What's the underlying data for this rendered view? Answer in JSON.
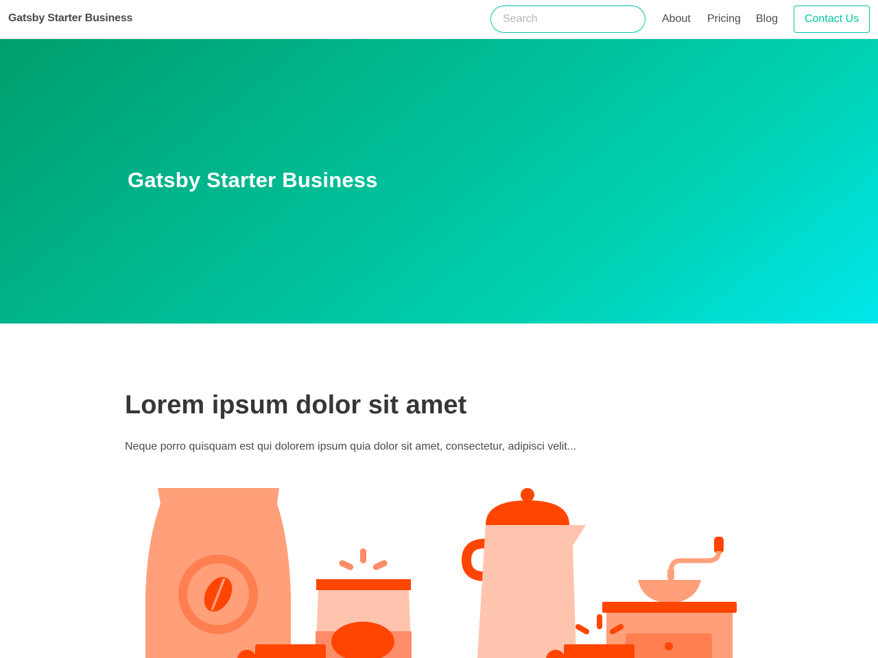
{
  "navbar": {
    "brand": "Gatsby Starter Business",
    "search_placeholder": "Search",
    "links": [
      {
        "label": "About"
      },
      {
        "label": "Pricing"
      },
      {
        "label": "Blog"
      }
    ],
    "contact_label": "Contact Us"
  },
  "hero": {
    "title": "Gatsby Starter Business"
  },
  "content": {
    "title": "Lorem ipsum dolor sit amet",
    "text": "Neque porro quisquam est qui dolorem ipsum quia dolor sit amet, consectetur, adipisci velit..."
  },
  "colors": {
    "accent": "#00c4a7",
    "hero_start": "#009e6c",
    "hero_end": "#00e7eb",
    "illustration_light": "#ffa07a",
    "illustration_pale": "#ffc4ad",
    "illustration_dark": "#ff4500"
  },
  "illustrations": {
    "left": "coffee-bag-and-jar-illustration",
    "right": "coffee-pot-and-grinder-illustration"
  }
}
